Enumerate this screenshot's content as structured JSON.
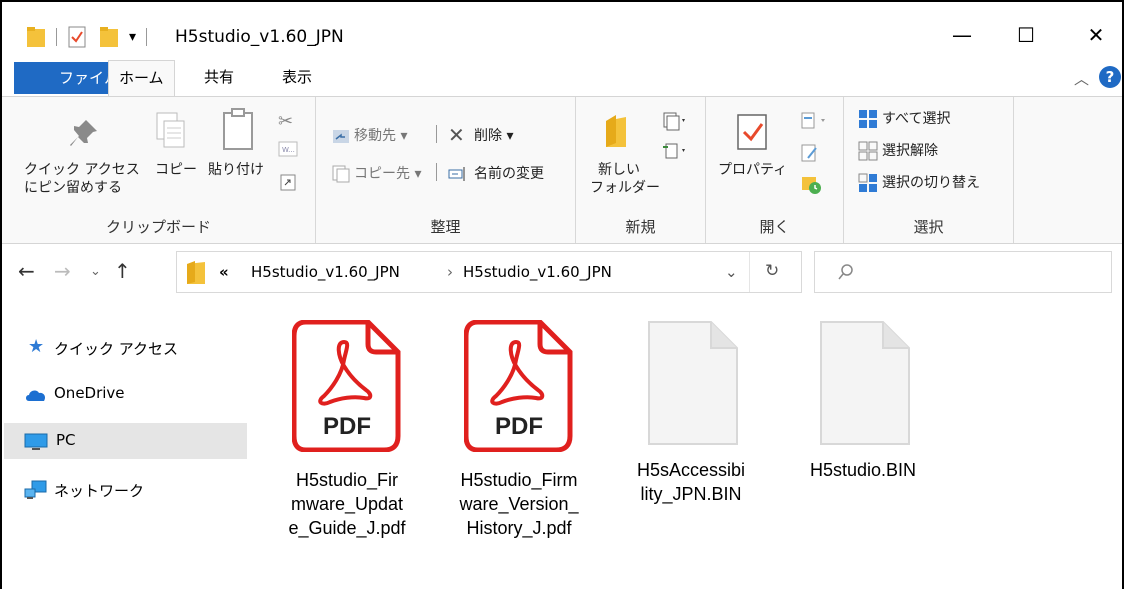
{
  "window": {
    "title": "H5studio_v1.60_JPN",
    "min_glyph": "—",
    "max_glyph": "☐",
    "close_glyph": "✕"
  },
  "tabs": {
    "file": "ファイル",
    "home": "ホーム",
    "share": "共有",
    "view": "表示"
  },
  "ribbon": {
    "clipboard": {
      "pin_line1": "クイック アクセス",
      "pin_line2": "にピン留めする",
      "copy": "コピー",
      "paste": "貼り付け",
      "label": "クリップボード"
    },
    "organize": {
      "move_to": "移動先 ▾",
      "copy_to": "コピー先 ▾",
      "delete": "削除 ▾",
      "rename": "名前の変更",
      "label": "整理"
    },
    "new": {
      "new_folder_line1": "新しい",
      "new_folder_line2": "フォルダー",
      "label": "新規"
    },
    "open": {
      "properties": "プロパティ",
      "label": "開く"
    },
    "select": {
      "select_all": "すべて選択",
      "select_none": "選択解除",
      "invert": "選択の切り替え",
      "label": "選択"
    }
  },
  "address": {
    "overflow": "«",
    "crumb1": "H5studio_v1.60_JPN",
    "crumb2": "H5studio_v1.60_JPN",
    "sep": "›"
  },
  "sidebar": {
    "items": [
      {
        "label": "クイック アクセス",
        "icon": "star-icon"
      },
      {
        "label": "OneDrive",
        "icon": "cloud-icon"
      },
      {
        "label": "PC",
        "icon": "monitor-icon",
        "selected": true
      },
      {
        "label": "ネットワーク",
        "icon": "network-icon"
      }
    ]
  },
  "files": [
    {
      "line1": "H5studio_Fir",
      "line2": "mware_Updat",
      "line3": "e_Guide_J.pdf",
      "badge": "PDF",
      "type": "pdf"
    },
    {
      "line1": "H5studio_Firm",
      "line2": "ware_Version_",
      "line3": "History_J.pdf",
      "badge": "PDF",
      "type": "pdf"
    },
    {
      "line1": "H5sAccessibi",
      "line2": "lity_JPN.BIN",
      "line3": "",
      "type": "bin"
    },
    {
      "line1": "H5studio.BIN",
      "line2": "",
      "line3": "",
      "type": "bin"
    }
  ],
  "colors": {
    "accent": "#1f6ac4",
    "pdf_red": "#e0201e",
    "folder": "#f4c23b"
  }
}
